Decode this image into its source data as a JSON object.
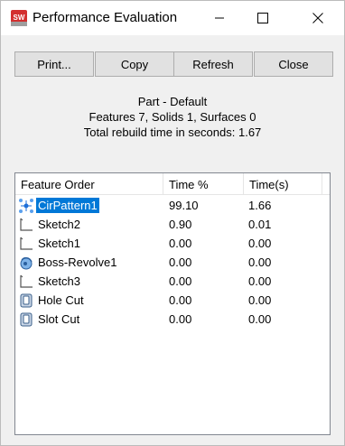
{
  "window": {
    "title": "Performance Evaluation"
  },
  "toolbar": {
    "print_label": "Print...",
    "copy_label": "Copy",
    "refresh_label": "Refresh",
    "close_label": "Close"
  },
  "summary": {
    "config": "Part - Default",
    "counts": "Features 7, Solids 1, Surfaces 0",
    "rebuild": "Total rebuild time in seconds: 1.67"
  },
  "table": {
    "headers": [
      "Feature Order",
      "Time %",
      "Time(s)"
    ],
    "rows": [
      {
        "name": "CirPattern1",
        "pct": "99.10",
        "sec": "1.66",
        "icon": "circular-pattern-icon",
        "selected": true
      },
      {
        "name": "Sketch2",
        "pct": "0.90",
        "sec": "0.01",
        "icon": "sketch-icon"
      },
      {
        "name": "Sketch1",
        "pct": "0.00",
        "sec": "0.00",
        "icon": "sketch-icon"
      },
      {
        "name": "Boss-Revolve1",
        "pct": "0.00",
        "sec": "0.00",
        "icon": "revolve-icon"
      },
      {
        "name": "Sketch3",
        "pct": "0.00",
        "sec": "0.00",
        "icon": "sketch-icon"
      },
      {
        "name": "Hole Cut",
        "pct": "0.00",
        "sec": "0.00",
        "icon": "cut-icon"
      },
      {
        "name": "Slot Cut",
        "pct": "0.00",
        "sec": "0.00",
        "icon": "cut-icon"
      }
    ]
  },
  "colors": {
    "selection": "#0078d7",
    "app_icon": "#d32f2f"
  }
}
